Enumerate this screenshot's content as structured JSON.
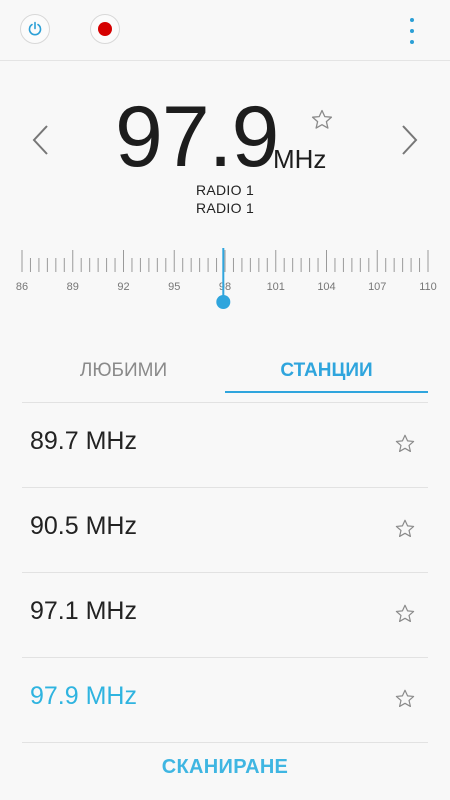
{
  "current": {
    "frequency": "97.9",
    "unit": "MHz",
    "station_lines": [
      "RADIO 1",
      "RADIO 1"
    ]
  },
  "tuner": {
    "labels": [
      "86",
      "89",
      "92",
      "95",
      "98",
      "101",
      "104",
      "107",
      "110"
    ],
    "min": 86,
    "max": 110,
    "value": 97.9
  },
  "tabs": [
    {
      "label": "ЛЮБИМИ",
      "selected": false
    },
    {
      "label": "СТАНЦИИ",
      "selected": true
    }
  ],
  "stations": [
    {
      "label": "89.7 MHz",
      "active": false
    },
    {
      "label": "90.5 MHz",
      "active": false
    },
    {
      "label": "97.1 MHz",
      "active": false
    },
    {
      "label": "97.9 MHz",
      "active": true
    }
  ],
  "scan_label": "СКАНИРАНЕ",
  "colors": {
    "accent": "#2fa5dd",
    "record": "#d50000",
    "active_text": "#2fb4e0"
  },
  "icons": {
    "power": "power-icon",
    "record": "record-icon",
    "menu": "more-vert-icon",
    "prev": "chevron-left-icon",
    "next": "chevron-right-icon",
    "favorite": "star-outline-icon"
  }
}
